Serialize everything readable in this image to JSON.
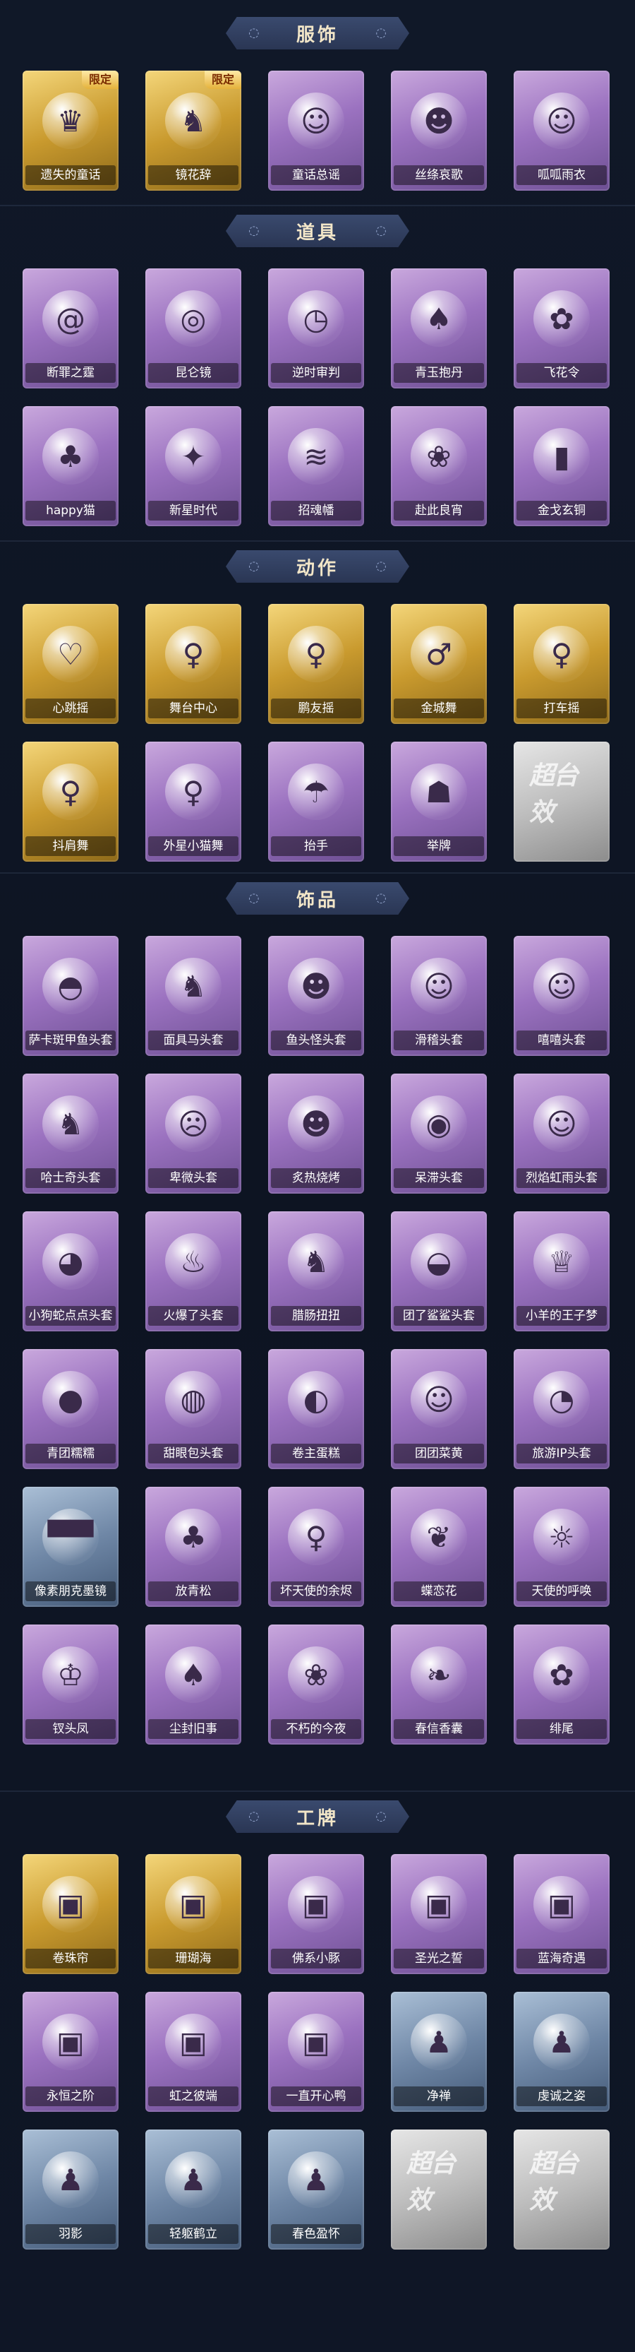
{
  "colors": {
    "purple": "#9b72c0",
    "gold": "#c99a2e",
    "gray": "#bdbdbd",
    "blue": "#6f87a6",
    "banner": "#2a3654"
  },
  "sections": [
    {
      "title": "服饰",
      "rows": [
        [
          {
            "label": "遗失的童话",
            "style": "gold",
            "tag": "限定",
            "icon": "girl-portrait-icon",
            "glyph": "♛"
          },
          {
            "label": "镜花辞",
            "style": "gold",
            "tag": "限定",
            "icon": "red-hood-portrait-icon",
            "glyph": "♞"
          },
          {
            "label": "童话总谣",
            "style": "purple",
            "icon": "girl-portrait-icon",
            "glyph": "☺"
          },
          {
            "label": "丝绦哀歌",
            "style": "purple",
            "icon": "girl-portrait-icon",
            "glyph": "☻"
          },
          {
            "label": "呱呱雨衣",
            "style": "purple",
            "icon": "frog-hood-portrait-icon",
            "glyph": "☺"
          }
        ]
      ]
    },
    {
      "title": "道具",
      "rows": [
        [
          {
            "label": "断罪之霆",
            "style": "purple",
            "icon": "swirl-staff-icon",
            "glyph": "@"
          },
          {
            "label": "昆仑镜",
            "style": "purple",
            "icon": "mirror-icon",
            "glyph": "◎"
          },
          {
            "label": "逆时审判",
            "style": "purple",
            "icon": "clock-icon",
            "glyph": "◷"
          },
          {
            "label": "青玉抱丹",
            "style": "purple",
            "icon": "vase-icon",
            "glyph": "♠"
          },
          {
            "label": "飞花令",
            "style": "purple",
            "icon": "flower-fan-icon",
            "glyph": "✿"
          }
        ],
        [
          {
            "label": "happy猫",
            "style": "purple",
            "icon": "cat-icon",
            "glyph": "♣"
          },
          {
            "label": "新星时代",
            "style": "purple",
            "icon": "revolver-icon",
            "glyph": "✦"
          },
          {
            "label": "招魂幡",
            "style": "purple",
            "icon": "banner-icon",
            "glyph": "≋"
          },
          {
            "label": "赴此良宵",
            "style": "purple",
            "icon": "lotus-icon",
            "glyph": "❀"
          },
          {
            "label": "金戈玄铜",
            "style": "purple",
            "icon": "lantern-icon",
            "glyph": "▮"
          }
        ]
      ]
    },
    {
      "title": "动作",
      "rows": [
        [
          {
            "label": "心跳摇",
            "style": "gold",
            "icon": "dance-pose-icon",
            "glyph": "♡"
          },
          {
            "label": "舞台中心",
            "style": "gold",
            "icon": "dance-pose-icon",
            "glyph": "♀"
          },
          {
            "label": "鹏友摇",
            "style": "gold",
            "icon": "dance-pose-icon",
            "glyph": "♀"
          },
          {
            "label": "金城舞",
            "style": "gold",
            "icon": "dance-pose-icon",
            "glyph": "♂"
          },
          {
            "label": "打车摇",
            "style": "gold",
            "icon": "dance-pose-icon",
            "glyph": "♀"
          }
        ],
        [
          {
            "label": "抖肩舞",
            "style": "gold",
            "icon": "dance-pose-icon",
            "glyph": "♀"
          },
          {
            "label": "外星小猫舞",
            "style": "purple",
            "icon": "dance-pose-icon",
            "glyph": "♀"
          },
          {
            "label": "抬手",
            "style": "purple",
            "icon": "ghost-pose-icon",
            "glyph": "☂"
          },
          {
            "label": "举牌",
            "style": "purple",
            "icon": "sign-holder-icon",
            "glyph": "☗"
          },
          {
            "label": "",
            "style": "gray",
            "icon": "watermark-logo-icon",
            "watermark": "超台效"
          }
        ]
      ]
    },
    {
      "title": "饰品",
      "rows": [
        [
          {
            "label": "萨卡斑甲鱼头套",
            "style": "purple",
            "icon": "fish-head-icon",
            "glyph": "◓"
          },
          {
            "label": "面具马头套",
            "style": "purple",
            "icon": "horse-head-icon",
            "glyph": "♞"
          },
          {
            "label": "鱼头怪头套",
            "style": "purple",
            "icon": "fish-monster-icon",
            "glyph": "☻"
          },
          {
            "label": "滑稽头套",
            "style": "purple",
            "icon": "smile-face-icon",
            "glyph": "☺"
          },
          {
            "label": "嘻嘻头套",
            "style": "purple",
            "icon": "grin-face-icon",
            "glyph": "☺"
          }
        ],
        [
          {
            "label": "哈士奇头套",
            "style": "purple",
            "icon": "dog-head-icon",
            "glyph": "♞"
          },
          {
            "label": "卑微头套",
            "style": "purple",
            "icon": "sad-face-icon",
            "glyph": "☹"
          },
          {
            "label": "炙热烧烤",
            "style": "purple",
            "icon": "bbq-icon",
            "glyph": "☻"
          },
          {
            "label": "呆滞头套",
            "style": "purple",
            "icon": "blank-face-icon",
            "glyph": "◉"
          },
          {
            "label": "烈焰虹雨头套",
            "style": "purple",
            "icon": "pikachu-icon",
            "glyph": "☺"
          }
        ],
        [
          {
            "label": "小狗蛇点点头套",
            "style": "purple",
            "icon": "dog-face-icon",
            "glyph": "◕"
          },
          {
            "label": "火爆了头套",
            "style": "purple",
            "icon": "fire-icon",
            "glyph": "♨"
          },
          {
            "label": "腊肠扭扭",
            "style": "purple",
            "icon": "dachshund-icon",
            "glyph": "♞"
          },
          {
            "label": "团了鲨鲨头套",
            "style": "purple",
            "icon": "shark-icon",
            "glyph": "◒"
          },
          {
            "label": "小羊的王子梦",
            "style": "purple",
            "icon": "sheep-icon",
            "glyph": "♕"
          }
        ],
        [
          {
            "label": "青团糯糯",
            "style": "purple",
            "icon": "rice-ball-icon",
            "glyph": "●"
          },
          {
            "label": "甜眼包头套",
            "style": "purple",
            "icon": "bun-icon",
            "glyph": "◍"
          },
          {
            "label": "卷主蛋糕",
            "style": "purple",
            "icon": "cake-roll-icon",
            "glyph": "◐"
          },
          {
            "label": "团团菜黄",
            "style": "purple",
            "icon": "cat-bun-icon",
            "glyph": "☺"
          },
          {
            "label": "旅游IP头套",
            "style": "purple",
            "icon": "duck-icon",
            "glyph": "◔"
          }
        ],
        [
          {
            "label": "像素朋克墨镜",
            "style": "blue",
            "icon": "pixel-sunglasses-icon",
            "glyph": "▀▀"
          },
          {
            "label": "放青松",
            "style": "purple",
            "icon": "bonsai-icon",
            "glyph": "♣"
          },
          {
            "label": "坏天使的余烬",
            "style": "purple",
            "icon": "angel-doll-icon",
            "glyph": "♀"
          },
          {
            "label": "蝶恋花",
            "style": "purple",
            "icon": "butterfly-icon",
            "glyph": "❦"
          },
          {
            "label": "天使的呼唤",
            "style": "purple",
            "icon": "angel-icon",
            "glyph": "☼"
          }
        ],
        [
          {
            "label": "钗头凤",
            "style": "purple",
            "icon": "phoenix-crown-icon",
            "glyph": "♔"
          },
          {
            "label": "尘封旧事",
            "style": "purple",
            "icon": "chibi-icon",
            "glyph": "♠"
          },
          {
            "label": "不朽的今夜",
            "style": "purple",
            "icon": "pink-cat-icon",
            "glyph": "❀"
          },
          {
            "label": "春信香囊",
            "style": "purple",
            "icon": "sachet-icon",
            "glyph": "❧"
          },
          {
            "label": "绯尾",
            "style": "purple",
            "icon": "fox-tail-icon",
            "glyph": "✿"
          }
        ]
      ]
    },
    {
      "title": "工牌",
      "rows": [
        [
          {
            "label": "卷珠帘",
            "style": "gold",
            "icon": "badge-card-icon",
            "glyph": "▣"
          },
          {
            "label": "珊瑚海",
            "style": "gold",
            "icon": "badge-card-icon",
            "glyph": "▣"
          },
          {
            "label": "佛系小豚",
            "style": "purple",
            "icon": "badge-card-icon",
            "glyph": "▣"
          },
          {
            "label": "圣光之誓",
            "style": "purple",
            "icon": "badge-card-icon",
            "glyph": "▣"
          },
          {
            "label": "蓝海奇遇",
            "style": "purple",
            "icon": "badge-card-icon",
            "glyph": "▣"
          }
        ],
        [
          {
            "label": "永恒之阶",
            "style": "purple",
            "icon": "badge-card-icon",
            "glyph": "▣"
          },
          {
            "label": "虹之彼端",
            "style": "purple",
            "icon": "badge-card-icon",
            "glyph": "▣"
          },
          {
            "label": "一直开心鸭",
            "style": "purple",
            "icon": "badge-card-icon",
            "glyph": "▣"
          },
          {
            "label": "净禅",
            "style": "blue",
            "icon": "silhouette-card-icon",
            "glyph": "♟"
          },
          {
            "label": "虔诚之姿",
            "style": "blue",
            "icon": "silhouette-card-icon",
            "glyph": "♟"
          }
        ],
        [
          {
            "label": "羽影",
            "style": "blue",
            "icon": "silhouette-card-icon",
            "glyph": "♟"
          },
          {
            "label": "轻躯鹤立",
            "style": "blue",
            "icon": "silhouette-card-icon",
            "glyph": "♟"
          },
          {
            "label": "春色盈怀",
            "style": "blue",
            "icon": "silhouette-card-icon",
            "glyph": "♟"
          },
          {
            "label": "",
            "style": "gray",
            "icon": "watermark-logo-icon",
            "watermark": "超台效"
          },
          {
            "label": "",
            "style": "gray",
            "icon": "watermark-logo-icon",
            "watermark": "超台效"
          }
        ]
      ]
    }
  ]
}
